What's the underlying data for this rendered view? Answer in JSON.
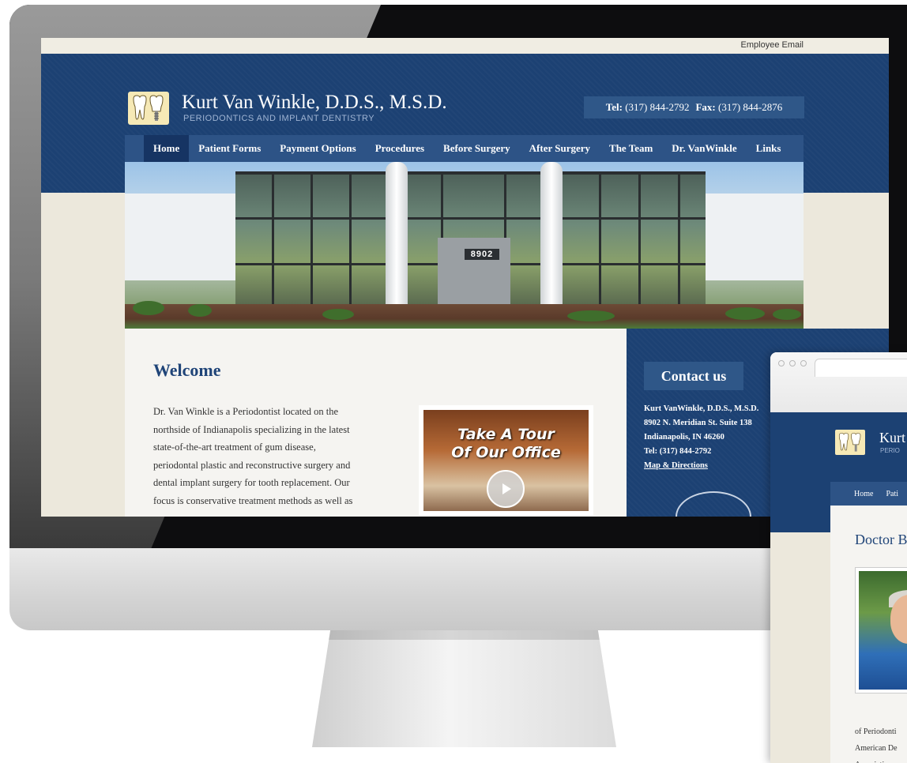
{
  "main_site": {
    "topbar": {
      "employee_email": "Employee Email"
    },
    "header": {
      "title": "Kurt Van Winkle, D.D.S., M.S.D.",
      "subtitle": "PERIODONTICS AND IMPLANT DENTISTRY",
      "tel_label": "Tel:",
      "tel": "(317) 844-2792",
      "fax_label": "Fax:",
      "fax": "(317) 844-2876"
    },
    "nav": [
      "Home",
      "Patient Forms",
      "Payment Options",
      "Procedures",
      "Before Surgery",
      "After Surgery",
      "The Team",
      "Dr. VanWinkle",
      "Links"
    ],
    "hero": {
      "building_number": "8902"
    },
    "welcome": {
      "heading": "Welcome",
      "lines": [
        "Dr. Van Winkle is a Periodontist located on the",
        "northside of Indianapolis specializing in the latest",
        "state-of-the-art treatment of gum disease,",
        "periodontal plastic and reconstructive surgery and",
        "dental implant surgery for tooth replacement.  Our",
        "focus is conservative treatment methods as well as"
      ]
    },
    "tour": {
      "line1": "Take A Tour",
      "line2": "Of Our Office"
    },
    "contact": {
      "button": "Contact us",
      "name": "Kurt VanWinkle, D.D.S., M.S.D.",
      "street": "8902 N. Meridian St. Suite 138",
      "city": "Indianapolis, IN 46260",
      "tel": "Tel: (317) 844-2792",
      "map_link": "Map & Directions"
    }
  },
  "second_window": {
    "title_fragment": "Kurt",
    "subtitle_fragment": "PERIO",
    "nav": [
      "Home",
      "Pati"
    ],
    "heading_fragment": "Doctor B",
    "text_lines": [
      "of Periodonti",
      "American De",
      "Association"
    ]
  }
}
